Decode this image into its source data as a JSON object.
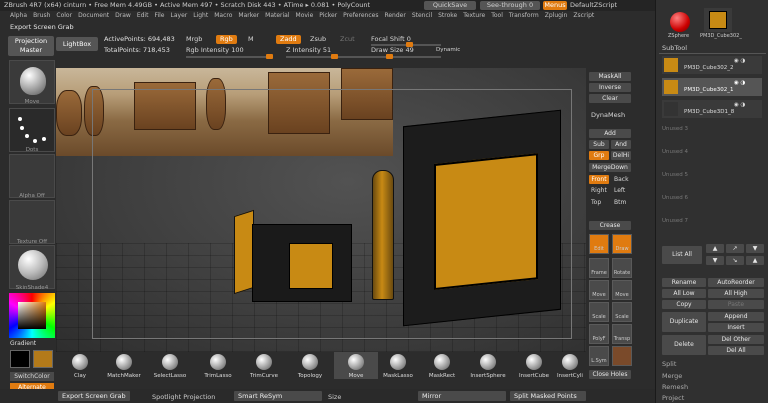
{
  "titlebar": {
    "text": "ZBrush 4R7 (x64)  cinturn  •  Free Mem 4.49GB • Active Mem 497 • Scratch Disk 443 •  ATime ▸ 0.081 • PolyCount",
    "quicksave": "QuickSave",
    "seethrough": "See-through  0",
    "menus": "Menus",
    "defaultscript": "DefaultZScript"
  },
  "menubar": [
    "Alpha",
    "Brush",
    "Color",
    "Document",
    "Draw",
    "Edit",
    "File",
    "Layer",
    "Light",
    "Macro",
    "Marker",
    "Material",
    "Movie",
    "Picker",
    "Preferences",
    "Render",
    "Stencil",
    "Stroke",
    "Texture",
    "Tool",
    "Transform",
    "Zplugin",
    "Zscript"
  ],
  "topleft": {
    "screengrab": "Export Screen Grab",
    "projection_master": "Projection Master",
    "lightbox": "LightBox"
  },
  "stats": {
    "active_points": "ActivePoints: 694,483",
    "total_points": "TotalPoints: 718,453"
  },
  "controls": {
    "mrgb": "Mrgb",
    "rgb": "Rgb",
    "m": "M",
    "zadd": "Zadd",
    "zsub": "Zsub",
    "zcut": "Zcut",
    "rgb_intensity": "Rgb Intensity 100",
    "z_intensity": "Z Intensity 51",
    "focal_shift": "Focal Shift 0",
    "draw_size": "Draw Size 49",
    "dynamic": "Dynamic"
  },
  "leftpanel": {
    "move": "Move",
    "dots": "Dots",
    "alpha_off": "Alpha Off",
    "texture_off": "Texture Off",
    "skinshade": "SkinShade4",
    "gradient": "Gradient",
    "switch_color": "SwitchColor",
    "alternate": "Alternate"
  },
  "rightcol": {
    "maskall": "MaskAll",
    "inverse": "Inverse",
    "clear": "Clear",
    "dynamesh": "DynaMesh",
    "add": "Add",
    "sub": "Sub",
    "and": "And",
    "grp": "Grp",
    "delhi": "DelHi",
    "mergedown": "MergeDown",
    "front": "Front",
    "back": "Back",
    "right": "Right",
    "left": "Left",
    "top": "Top",
    "btm": "Btm",
    "crease": "Crease",
    "edit": "Edit",
    "draw": "Draw",
    "frame": "Frame",
    "rotate": "Rotate",
    "move": "Move",
    "move2": "Move",
    "scale": "Scale",
    "scale2": "Scale",
    "polyf": "PolyF",
    "transp": "Transp",
    "lsym": "L.Sym",
    "close_holes": "Close Holes"
  },
  "subtool": {
    "zsphere": "ZSphere",
    "cube_top": "PM3D_Cube302_",
    "header": "SubTool",
    "items": [
      "PM3D_Cube302_2",
      "PM3D_Cube302_1",
      "PM3D_Cube3D1_8",
      "Unused 3",
      "Unused 4",
      "Unused 5",
      "Unused 6",
      "Unused 7"
    ],
    "list_all": "List All",
    "rename": "Rename",
    "autoreorder": "AutoReorder",
    "all_low": "All Low",
    "all_high": "All High",
    "copy": "Copy",
    "paste": "Paste",
    "append": "Append",
    "duplicate": "Duplicate",
    "insert": "Insert",
    "delete": "Delete",
    "del_other": "Del Other",
    "del_all": "Del All",
    "split": "Split",
    "merge": "Merge",
    "remesh": "Remesh",
    "project": "Project"
  },
  "shelf": [
    "Clay",
    "MatchMaker",
    "SelectLasso",
    "TrimLasso",
    "TrimCurve",
    "Topology",
    "Move",
    "MaskLasso",
    "MaskRect",
    "InsertSphere",
    "InsertCube",
    "InsertCyli"
  ],
  "bottombar": {
    "screengrab": "Export Screen Grab",
    "spotlight": "Spotlight Projection",
    "smart_resym": "Smart ReSym",
    "size": "Size",
    "mirror": "Mirror",
    "split_masked": "Split Masked Points"
  }
}
